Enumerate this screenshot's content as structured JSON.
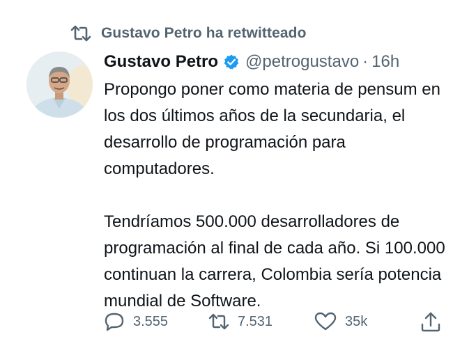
{
  "retweet_notice": {
    "label": "Gustavo Petro ha retwitteado",
    "icon": "retweet-icon"
  },
  "tweet": {
    "author": {
      "name": "Gustavo Petro",
      "handle": "@petrogustavo",
      "verified": true
    },
    "separator": "·",
    "time": "16h",
    "text_lines": [
      "Propongo poner como materia de pensum en",
      "los dos últimos años de la secundaria, el",
      "desarrollo de programación para",
      "computadores.",
      "",
      "Tendríamos 500.000 desarrolladores de",
      "programación al final de cada año. Si 100.000",
      "continuan la carrera, Colombia sería potencia",
      "mundial de Software."
    ]
  },
  "actions": {
    "reply": {
      "count": "3.555",
      "icon": "reply-icon"
    },
    "retweet": {
      "count": "7.531",
      "icon": "retweet-icon"
    },
    "like": {
      "count": "35k",
      "icon": "heart-icon"
    },
    "share": {
      "icon": "share-icon"
    }
  },
  "colors": {
    "text": "#0f1419",
    "secondary": "#536471",
    "verified": "#1d9bf0"
  }
}
